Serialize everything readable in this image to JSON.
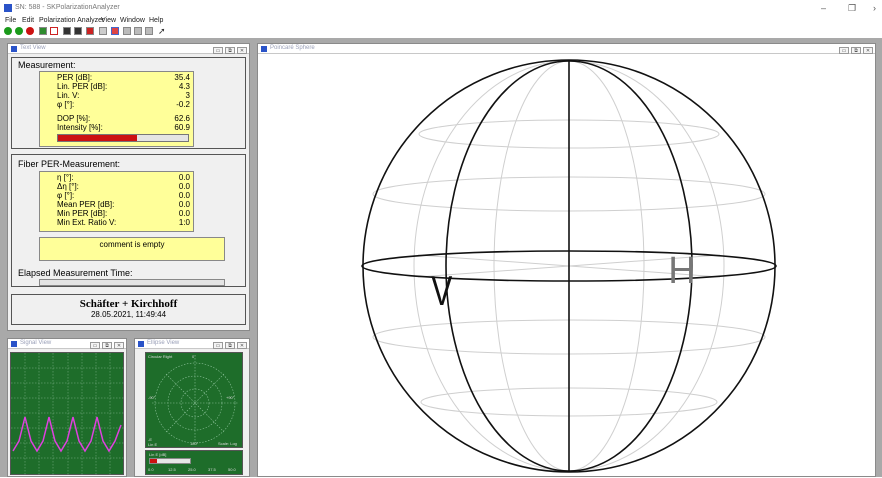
{
  "app": {
    "title": "SN: 588 - SKPolarizationAnalyzer",
    "window_controls": {
      "minimize": "–",
      "restore": "❐",
      "close": "›"
    }
  },
  "menu": [
    "File",
    "Edit",
    "Polarization Analyzer",
    "View",
    "Window",
    "Help"
  ],
  "toolbar_icons": [
    "green-dot-icon",
    "green-dot-icon",
    "red-dot-icon",
    "green-signal-icon",
    "red-graph-icon",
    "save-icon",
    "save-icon",
    "red-box-icon",
    "grid-icon",
    "color-icon",
    "grid-icon",
    "grid-icon",
    "grid-icon",
    "wand-icon"
  ],
  "text_view": {
    "title": "Text View",
    "measurement": {
      "heading": "Measurement:",
      "rows": [
        {
          "label": "PER [dB]:",
          "value": "35.4"
        },
        {
          "label": "Lin. PER [dB]:",
          "value": "4.3"
        },
        {
          "label": "Lin. V:",
          "value": "3"
        },
        {
          "label": "φ [°]:",
          "value": "-0.2"
        },
        {
          "label": "DOP [%]:",
          "value": "62.6"
        },
        {
          "label": "Intensity [%]:",
          "value": "60.9"
        }
      ],
      "intensity_fraction": 0.609
    },
    "fiber": {
      "heading": "Fiber PER-Measurement:",
      "rows": [
        {
          "label": "η [°]:",
          "value": "0.0"
        },
        {
          "label": "Δη [°]:",
          "value": "0.0"
        },
        {
          "label": "φ [°]:",
          "value": "0.0"
        },
        {
          "label": "Mean PER [dB]:",
          "value": "0.0"
        },
        {
          "label": "Min  PER [dB]:",
          "value": "0.0"
        },
        {
          "label": "Min Ext. Ratio V:",
          "value": "1:0"
        }
      ],
      "comment": "comment is empty",
      "elapsed_label": "Elapsed Measurement Time:"
    },
    "footer": {
      "brand": "Schäfter + Kirchhoff",
      "timestamp": "28.05.2021, 11:49:44"
    }
  },
  "signal_view": {
    "title": "Signal View"
  },
  "ellipse_view": {
    "title": "Ellipse View",
    "labels": {
      "top_left": "Circular  Right",
      "top_center": "0°",
      "left": "-90°",
      "right": "+90°",
      "bottom_left": "-E\nLin E",
      "bottom_center": "180°",
      "bottom_right": "Scale: Log"
    },
    "bar_label": "Lin E [dB]",
    "scale": [
      "0.0",
      "12.5",
      "25.0",
      "37.5",
      "50.0"
    ]
  },
  "poincare": {
    "title": "Poincaré Sphere",
    "labels": {
      "v": "V",
      "h": "H"
    }
  },
  "colors": {
    "yellow": "#ffff99",
    "intensity_bar": "#cc1111",
    "scope_green": "#1e6d2a",
    "trace": "#e040e0"
  }
}
